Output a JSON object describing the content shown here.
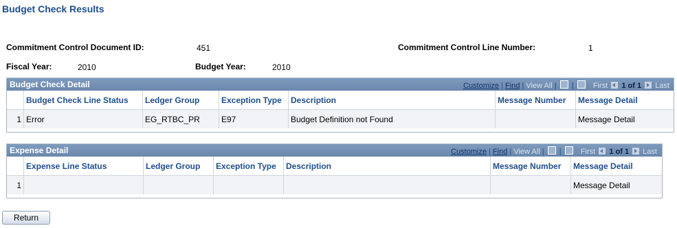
{
  "page_title": "Budget Check Results",
  "header": {
    "doc_id_label": "Commitment Control Document ID:",
    "doc_id_value": "451",
    "line_number_label": "Commitment Control Line Number:",
    "line_number_value": "1",
    "fiscal_year_label": "Fiscal Year:",
    "fiscal_year_value": "2010",
    "budget_year_label": "Budget Year:",
    "budget_year_value": "2010"
  },
  "grid_nav": {
    "customize": "Customize",
    "find": "Find",
    "sep": "|",
    "view_all": "View All",
    "first": "First",
    "of": "1 of 1",
    "last": "Last"
  },
  "budget_grid": {
    "title": "Budget Check Detail",
    "columns": [
      "Budget Check Line Status",
      "Ledger Group",
      "Exception Type",
      "Description",
      "Message Number",
      "Message Detail"
    ],
    "rows": [
      {
        "num": "1",
        "status": "Error",
        "ledger_group": "EG_RTBC_PR",
        "exception_type": "E97",
        "description": "Budget Definition not Found",
        "message_number": "",
        "message_detail": "Message Detail"
      }
    ]
  },
  "expense_grid": {
    "title": "Expense Detail",
    "columns": [
      "Expense Line Status",
      "Ledger Group",
      "Exception Type",
      "Description",
      "Message Number",
      "Message Detail"
    ],
    "rows": [
      {
        "num": "1",
        "status": "",
        "ledger_group": "",
        "exception_type": "",
        "description": "",
        "message_number": "",
        "message_detail": "Message Detail"
      }
    ]
  },
  "return_button": "Return"
}
